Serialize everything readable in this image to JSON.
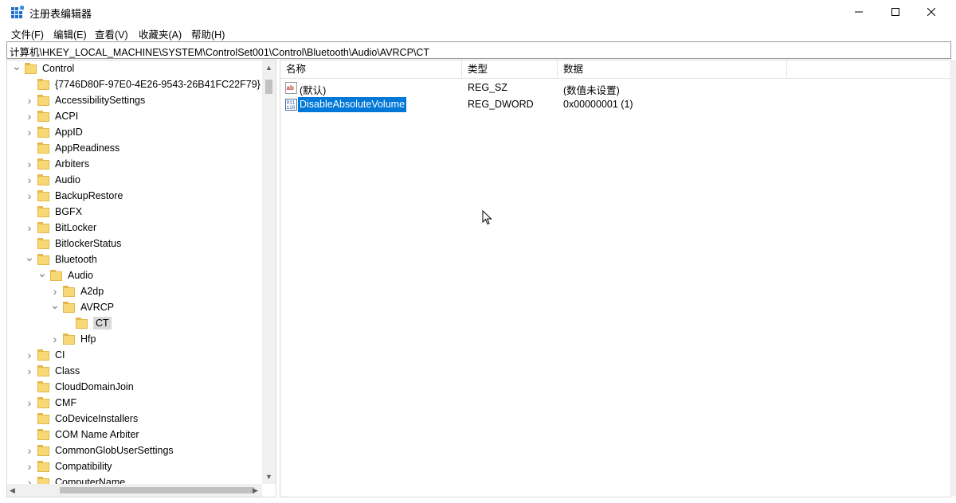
{
  "window": {
    "title": "注册表编辑器"
  },
  "menu": [
    {
      "label": "文件(F)"
    },
    {
      "label": "编辑(E)"
    },
    {
      "label": "查看(V)"
    },
    {
      "label": "收藏夹(A)"
    },
    {
      "label": "帮助(H)"
    }
  ],
  "address": {
    "path": "计算机\\HKEY_LOCAL_MACHINE\\SYSTEM\\ControlSet001\\Control\\Bluetooth\\Audio\\AVRCP\\CT"
  },
  "tree": [
    {
      "label": "Control",
      "level": 0,
      "state": "expanded"
    },
    {
      "label": "{7746D80F-97E0-4E26-9543-26B41FC22F79}",
      "level": 1,
      "state": "leaf"
    },
    {
      "label": "AccessibilitySettings",
      "level": 1,
      "state": "collapsed"
    },
    {
      "label": "ACPI",
      "level": 1,
      "state": "collapsed"
    },
    {
      "label": "AppID",
      "level": 1,
      "state": "collapsed"
    },
    {
      "label": "AppReadiness",
      "level": 1,
      "state": "leaf"
    },
    {
      "label": "Arbiters",
      "level": 1,
      "state": "collapsed"
    },
    {
      "label": "Audio",
      "level": 1,
      "state": "collapsed"
    },
    {
      "label": "BackupRestore",
      "level": 1,
      "state": "collapsed"
    },
    {
      "label": "BGFX",
      "level": 1,
      "state": "leaf"
    },
    {
      "label": "BitLocker",
      "level": 1,
      "state": "collapsed"
    },
    {
      "label": "BitlockerStatus",
      "level": 1,
      "state": "leaf"
    },
    {
      "label": "Bluetooth",
      "level": 1,
      "state": "expanded"
    },
    {
      "label": "Audio",
      "level": 2,
      "state": "expanded"
    },
    {
      "label": "A2dp",
      "level": 3,
      "state": "collapsed"
    },
    {
      "label": "AVRCP",
      "level": 3,
      "state": "expanded"
    },
    {
      "label": "CT",
      "level": 4,
      "state": "selected"
    },
    {
      "label": "Hfp",
      "level": 3,
      "state": "collapsed"
    },
    {
      "label": "CI",
      "level": 1,
      "state": "collapsed"
    },
    {
      "label": "Class",
      "level": 1,
      "state": "collapsed"
    },
    {
      "label": "CloudDomainJoin",
      "level": 1,
      "state": "leaf"
    },
    {
      "label": "CMF",
      "level": 1,
      "state": "collapsed"
    },
    {
      "label": "CoDeviceInstallers",
      "level": 1,
      "state": "leaf"
    },
    {
      "label": "COM Name Arbiter",
      "level": 1,
      "state": "leaf"
    },
    {
      "label": "CommonGlobUserSettings",
      "level": 1,
      "state": "collapsed"
    },
    {
      "label": "Compatibility",
      "level": 1,
      "state": "collapsed"
    },
    {
      "label": "ComputerName",
      "level": 1,
      "state": "collapsed"
    }
  ],
  "columns": {
    "name": "名称",
    "type": "类型",
    "data": "数据"
  },
  "values": [
    {
      "name": "(默认)",
      "type": "REG_SZ",
      "data": "(数值未设置)",
      "icon": "string-value-icon",
      "selected": false
    },
    {
      "name": "DisableAbsoluteVolume",
      "type": "REG_DWORD",
      "data": "0x00000001 (1)",
      "icon": "dword-value-icon",
      "selected": true
    }
  ]
}
